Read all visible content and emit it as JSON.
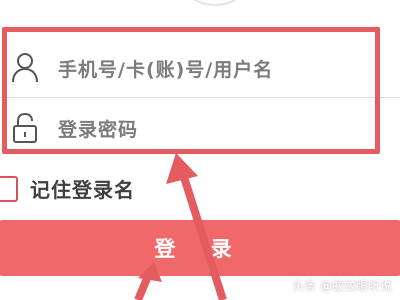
{
  "login_form": {
    "username_placeholder": "手机号/卡(账)号/用户名",
    "password_placeholder": "登录密码",
    "remember_label": "记住登录名",
    "login_button_label": "登 录"
  },
  "icons": {
    "username": "person-icon",
    "password": "lock-icon"
  },
  "watermark": {
    "text": "头条 @蚊蚊眼听说"
  },
  "colors": {
    "highlight": "#e45b60",
    "login_button": "#f0686a",
    "arrow": "#e45b60"
  }
}
